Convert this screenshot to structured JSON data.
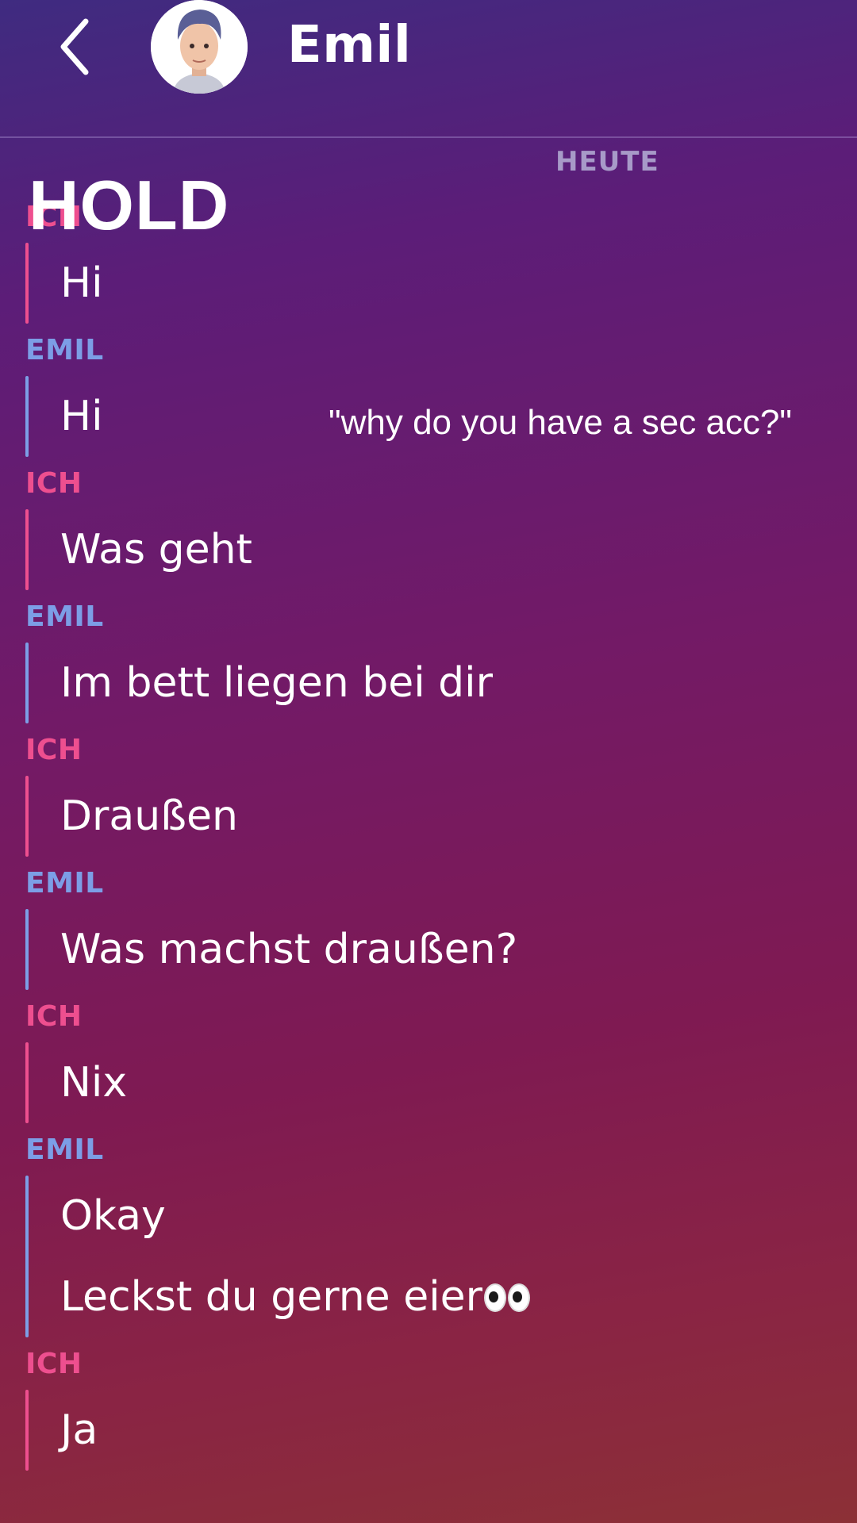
{
  "header": {
    "contact_name": "Emil",
    "back_icon": "chevron-left-icon",
    "avatar_icon": "bitmoji-avatar"
  },
  "date_label": "HEUTE",
  "overlay": {
    "hold_text": "HOLD",
    "caption": "\"why do you have a sec acc?\""
  },
  "sender_labels": {
    "me": "ICH",
    "contact": "EMIL"
  },
  "messages": [
    {
      "sender": "ICH",
      "lines": [
        "Hi"
      ]
    },
    {
      "sender": "EMIL",
      "lines": [
        "Hi"
      ]
    },
    {
      "sender": "ICH",
      "lines": [
        "Was geht"
      ]
    },
    {
      "sender": "EMIL",
      "lines": [
        "Im bett liegen bei dir"
      ]
    },
    {
      "sender": "ICH",
      "lines": [
        "Draußen"
      ]
    },
    {
      "sender": "EMIL",
      "lines": [
        "Was machst draußen?"
      ]
    },
    {
      "sender": "ICH",
      "lines": [
        "Nix"
      ]
    },
    {
      "sender": "EMIL",
      "lines": [
        "Okay",
        "Leckst du gerne eier"
      ]
    },
    {
      "sender": "ICH",
      "lines": [
        "Ja"
      ]
    }
  ],
  "emoji": {
    "eyes_icon": "eyes-emoji-icon"
  },
  "colors": {
    "me_accent": "#ee4f8f",
    "contact_accent": "#7c9ee6",
    "date_label": "#a79ac8"
  }
}
